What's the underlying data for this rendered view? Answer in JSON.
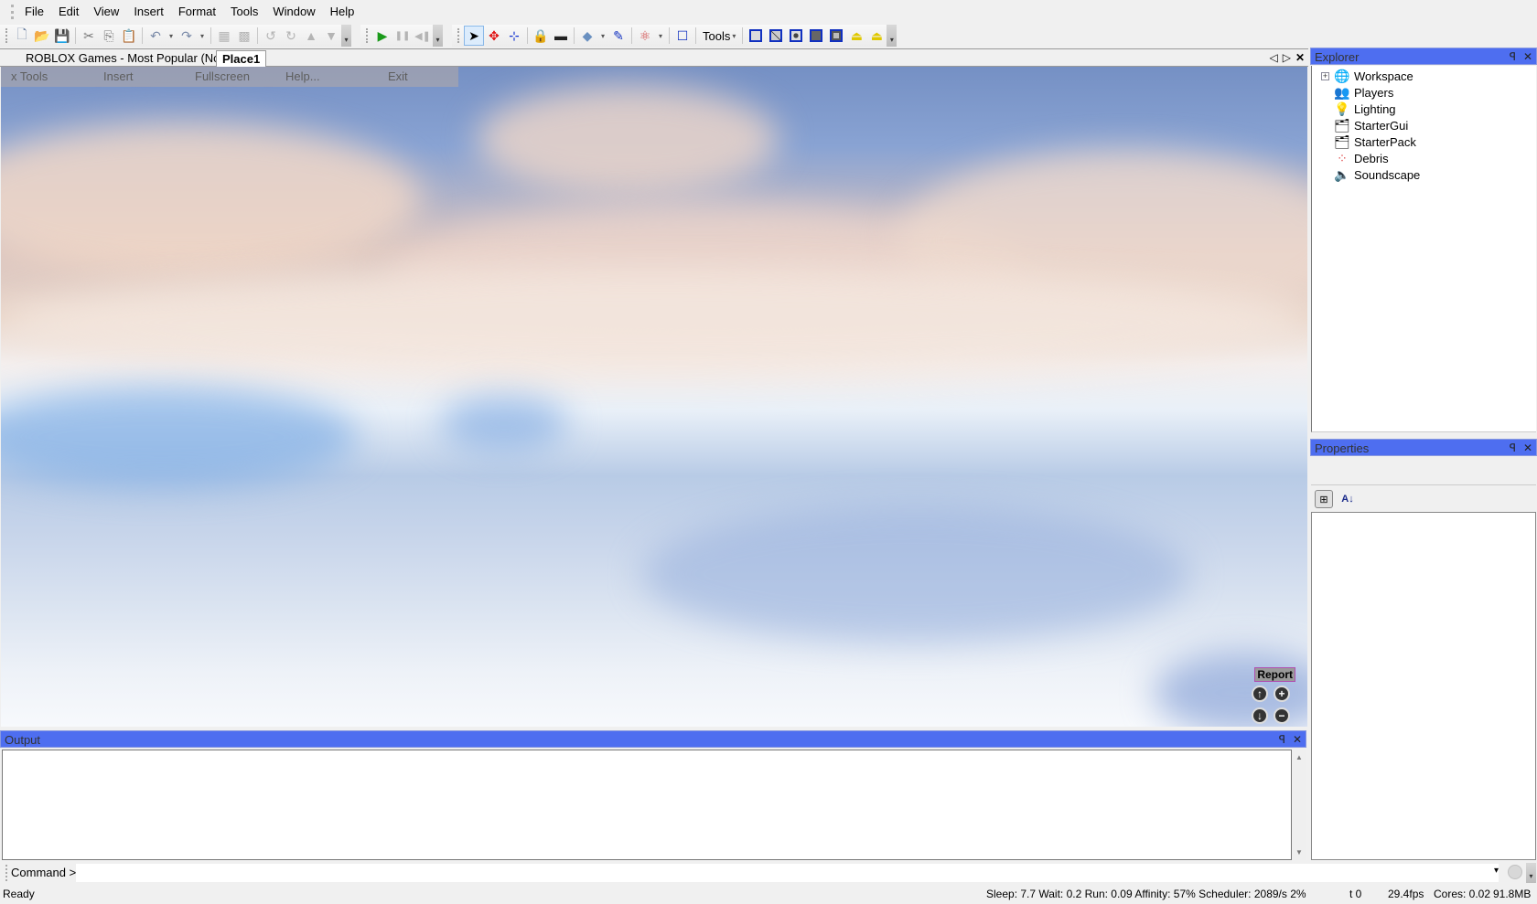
{
  "menubar": {
    "items": [
      "File",
      "Edit",
      "View",
      "Insert",
      "Format",
      "Tools",
      "Window",
      "Help"
    ]
  },
  "toolbar": {
    "standard": [
      "new-icon",
      "open-icon",
      "save-icon",
      "cut-icon",
      "copy-icon",
      "paste-icon",
      "undo-icon",
      "redo-icon",
      "group-icon",
      "ungroup-icon",
      "rotate-icon",
      "tilt-icon",
      "move-up-icon",
      "move-down-icon"
    ],
    "run": [
      "play-icon",
      "pause-icon",
      "stop-icon"
    ],
    "tools_label": "Tools",
    "glyphs": {
      "new": "🗋",
      "open": "📂",
      "save": "💾",
      "cut": "✂",
      "copy": "⎘",
      "paste": "📋",
      "undo": "↶",
      "redo": "↷",
      "group": "▦",
      "ungroup": "▩",
      "rotate": "↺",
      "tilt": "↻",
      "up": "▲",
      "down": "▼",
      "play": "▶",
      "pause": "❚❚",
      "stop": "◀❚",
      "select": "➤",
      "move": "✥",
      "resize": "⊹",
      "lock": "🔒",
      "anchor": "▬",
      "paint": "◆",
      "dropper": "✎",
      "physics": "⚛",
      "frame": "☐",
      "dropdown": "▾",
      "overflow": "▾"
    }
  },
  "tabs": {
    "items": [
      {
        "label": "ROBLOX Games - Most Popular (Now)",
        "active": false
      },
      {
        "label": "Place1",
        "active": true
      }
    ],
    "controls": {
      "prev": "◁",
      "next": "▷",
      "close": "✕"
    }
  },
  "viewport": {
    "game_menu": [
      "x Tools",
      "Insert",
      "Fullscreen",
      "Help...",
      "Exit"
    ],
    "report_label": "Report",
    "camera": {
      "up": "↑",
      "zoom_in": "+",
      "down": "↓",
      "zoom_out": "−"
    }
  },
  "output": {
    "title": "Output",
    "pin": "ꟼ",
    "close": "✕",
    "scroll_up": "▲",
    "scroll_down": "▼"
  },
  "command": {
    "label": "Command >",
    "value": "",
    "dropdown": "▾"
  },
  "status": {
    "ready": "Ready",
    "perf": "Sleep: 7.7 Wait: 0.2 Run: 0.09 Affinity: 57% Scheduler: 2089/s 2%",
    "t": "t 0",
    "fps": "29.4fps",
    "cores": "Cores: 0.02",
    "memory": "91.8MB"
  },
  "explorer": {
    "title": "Explorer",
    "pin": "ꟼ",
    "close": "✕",
    "items": [
      {
        "label": "Workspace",
        "icon": "🌐",
        "expandable": true
      },
      {
        "label": "Players",
        "icon": "👥",
        "expandable": false
      },
      {
        "label": "Lighting",
        "icon": "💡",
        "expandable": false
      },
      {
        "label": "StarterGui",
        "icon": "🗂",
        "expandable": false
      },
      {
        "label": "StarterPack",
        "icon": "🗂",
        "expandable": false
      },
      {
        "label": "Debris",
        "icon": "⁘",
        "expandable": false
      },
      {
        "label": "Soundscape",
        "icon": "🔈",
        "expandable": false
      }
    ],
    "expand_glyph": "+"
  },
  "properties": {
    "title": "Properties",
    "pin": "ꟼ",
    "close": "✕",
    "categorized_glyph": "⊞",
    "alpha_glyph": "A↓"
  }
}
